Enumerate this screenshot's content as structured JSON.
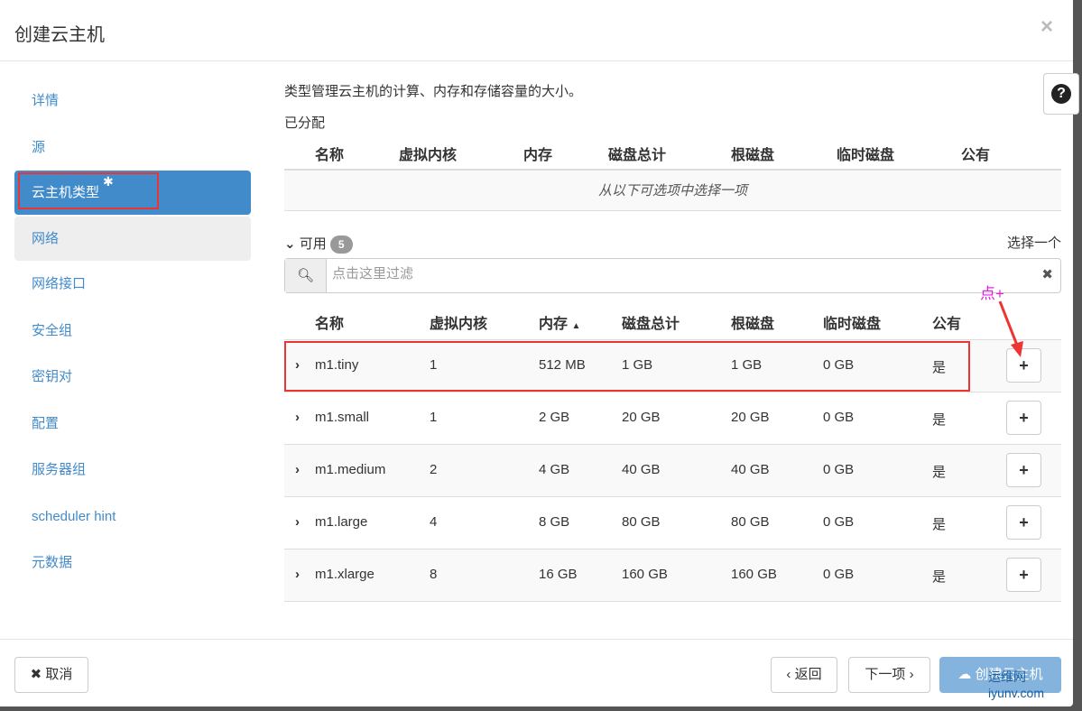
{
  "dialog": {
    "title": "创建云主机",
    "close": "×"
  },
  "sidebar": {
    "items": [
      {
        "label": "详情"
      },
      {
        "label": "源"
      },
      {
        "label": "云主机类型",
        "required": "✱"
      },
      {
        "label": "网络"
      },
      {
        "label": "网络接口"
      },
      {
        "label": "安全组"
      },
      {
        "label": "密钥对"
      },
      {
        "label": "配置"
      },
      {
        "label": "服务器组"
      },
      {
        "label": "scheduler hint"
      },
      {
        "label": "元数据"
      }
    ]
  },
  "main": {
    "description": "类型管理云主机的计算、内存和存储容量的大小。",
    "help": "?",
    "allocated": {
      "label": "已分配",
      "columns": [
        "名称",
        "虚拟内核",
        "内存",
        "磁盘总计",
        "根磁盘",
        "临时磁盘",
        "公有"
      ],
      "empty": "从以下可选项中选择一项"
    },
    "available": {
      "label": "可用",
      "count": "5",
      "select_hint": "选择一个",
      "filter_placeholder": "点击这里过滤",
      "columns": [
        "名称",
        "虚拟内核",
        "内存",
        "磁盘总计",
        "根磁盘",
        "临时磁盘",
        "公有"
      ],
      "sort_indicator": "▲",
      "rows": [
        {
          "name": "m1.tiny",
          "vcpus": "1",
          "ram": "512 MB",
          "total_disk": "1 GB",
          "root_disk": "1 GB",
          "ephemeral": "0 GB",
          "public": "是"
        },
        {
          "name": "m1.small",
          "vcpus": "1",
          "ram": "2 GB",
          "total_disk": "20 GB",
          "root_disk": "20 GB",
          "ephemeral": "0 GB",
          "public": "是"
        },
        {
          "name": "m1.medium",
          "vcpus": "2",
          "ram": "4 GB",
          "total_disk": "40 GB",
          "root_disk": "40 GB",
          "ephemeral": "0 GB",
          "public": "是"
        },
        {
          "name": "m1.large",
          "vcpus": "4",
          "ram": "8 GB",
          "total_disk": "80 GB",
          "root_disk": "80 GB",
          "ephemeral": "0 GB",
          "public": "是"
        },
        {
          "name": "m1.xlarge",
          "vcpus": "8",
          "ram": "16 GB",
          "total_disk": "160 GB",
          "root_disk": "160 GB",
          "ephemeral": "0 GB",
          "public": "是"
        }
      ]
    }
  },
  "annotation": "点+",
  "footer": {
    "cancel": "取消",
    "back": "‹ 返回",
    "next": "下一项 ›",
    "create": "创建云主机"
  },
  "watermark": "运维网 iyunv.com"
}
